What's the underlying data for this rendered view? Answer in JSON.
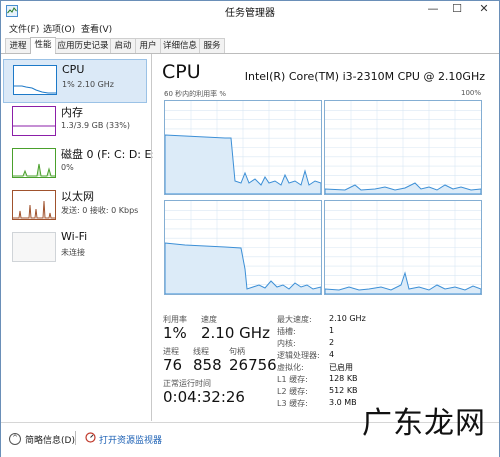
{
  "window": {
    "title": "任务管理器",
    "minimize": "—",
    "maximize": "☐",
    "close": "✕"
  },
  "menu": [
    "文件(F)",
    "选项(O)",
    "查看(V)"
  ],
  "tabs": [
    "进程",
    "性能",
    "应用历史记录",
    "启动",
    "用户",
    "详细信息",
    "服务"
  ],
  "active_tab": "性能",
  "resources": [
    {
      "title": "CPU",
      "sub": "1% 2.10 GHz",
      "color": "#1d79c8"
    },
    {
      "title": "内存",
      "sub": "1.3/3.9 GB (33%)",
      "color": "#8b1fa8"
    },
    {
      "title": "磁盘 0 (F: C: D: E:",
      "sub": "0%",
      "color": "#4aa02c"
    },
    {
      "title": "以太网",
      "sub": "发送: 0 接收: 0 Kbps",
      "color": "#a0522d"
    },
    {
      "title": "Wi-Fi",
      "sub": "未连接",
      "color": "#9aa0a6"
    }
  ],
  "detail": {
    "title": "CPU",
    "cpu_name": "Intel(R) Core(TM) i3-2310M CPU @ 2.10GHz",
    "graph_label": "60 秒内的利用率 %",
    "graph_max": "100%",
    "utilization_label": "利用率",
    "utilization": "1%",
    "speed_label": "速度",
    "speed": "2.10 GHz",
    "processes_label": "进程",
    "processes": "76",
    "threads_label": "线程",
    "threads": "858",
    "handles_label": "句柄",
    "handles": "26756",
    "uptime_label": "正常运行时间",
    "uptime": "0:04:32:26",
    "specs": [
      {
        "label": "最大速度:",
        "value": "2.10 GHz"
      },
      {
        "label": "插槽:",
        "value": "1"
      },
      {
        "label": "内核:",
        "value": "2"
      },
      {
        "label": "逻辑处理器:",
        "value": "4"
      },
      {
        "label": "虚拟化:",
        "value": "已启用"
      },
      {
        "label": "L1 缓存:",
        "value": "128 KB"
      },
      {
        "label": "L2 缓存:",
        "value": "512 KB"
      },
      {
        "label": "L3 缓存:",
        "value": "3.0 MB"
      }
    ]
  },
  "footer": {
    "fewer_details": "简略信息(D)",
    "resource_monitor": "打开资源监视器"
  },
  "watermark": "广东龙网",
  "colors": {
    "cpu_line": "#3c8fd6",
    "cpu_fill": "#dcebf8",
    "grid": "#d9e7f3"
  }
}
